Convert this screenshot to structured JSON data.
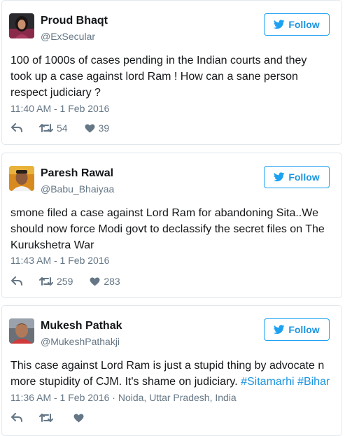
{
  "colors": {
    "accent": "#1da1f2",
    "meta_text": "#657786",
    "body_text": "#14171a"
  },
  "icons": {
    "follow": "twitter-bird-icon",
    "reply": "reply-arrow-icon",
    "retweet": "retweet-icon",
    "like": "heart-icon"
  },
  "follow_label": "Follow",
  "tweets": [
    {
      "name": "Proud Bhaqt",
      "handle": "@ExSecular",
      "lines": [
        "100 of 1000s of cases pending in the Indian courts and they",
        "took up a case against lord Ram ! How can a sane person",
        "respect judiciary ?"
      ],
      "timestamp": "11:40 AM - 1 Feb 2016",
      "retweets": "54",
      "likes": "39"
    },
    {
      "name": "Paresh Rawal",
      "handle": "@Babu_Bhaiyaa",
      "lines": [
        "smone filed a case against Lord Ram for abandoning Sita..We",
        "should now force Modi govt to declassify the secret files on The",
        "Kurukshetra War"
      ],
      "timestamp": "11:43 AM - 1 Feb 2016",
      "retweets": "259",
      "likes": "283"
    },
    {
      "name": "Mukesh Pathak",
      "handle": "@MukeshPathakji",
      "lines": [
        "This case against Lord Ram is just a stupid thing by advocate n",
        "more stupidity of CJM. It's shame on judiciary."
      ],
      "hashtags": [
        "#Sitamarhi",
        "#Bihar"
      ],
      "timestamp": "11:36 AM - 1 Feb 2016",
      "location": "Noida, Uttar Pradesh, India",
      "meta_separator": " · ",
      "retweets": "",
      "likes": ""
    }
  ]
}
